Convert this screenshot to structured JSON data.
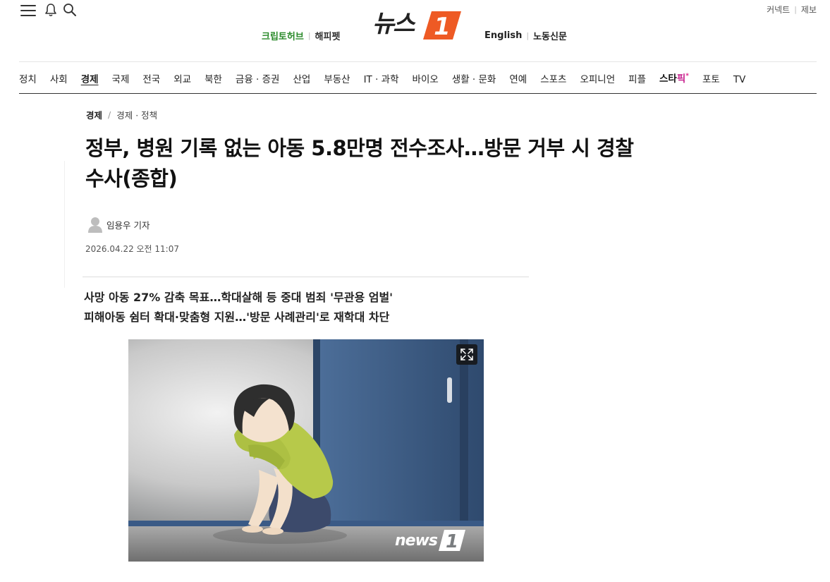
{
  "header": {
    "logo_text": "뉴스",
    "logo_number": "1",
    "util_links": [
      "커넥트",
      "제보"
    ],
    "left_links": [
      "크립토허브",
      "해피펫"
    ],
    "right_links": [
      "English",
      "노동신문"
    ]
  },
  "gnb": {
    "items": [
      "정치",
      "사회",
      "경제",
      "국제",
      "전국",
      "외교",
      "북한",
      "금융 · 증권",
      "산업",
      "부동산",
      "IT · 과학",
      "바이오",
      "생활 · 문화",
      "연예",
      "스포츠",
      "오피니언",
      "피플"
    ],
    "starpick_a": "스타",
    "starpick_b": "픽",
    "starpick_mark": "*",
    "tail": [
      "포토",
      "TV"
    ],
    "active": "경제"
  },
  "article": {
    "breadcrumb_main": "경제",
    "breadcrumb_sep": "/",
    "breadcrumb_sub": "경제 · 정책",
    "headline_line1": "정부, 병원 기록 없는 아동 5.8만명 전수조사…방문 거부 시 경찰",
    "headline_line2": "수사(종합)",
    "reporter": "임용우 기자",
    "timestamp": "2026.04.22 오전 11:07",
    "summary_line1": "사망 아동 27% 감축 목표…학대살해 등 중대 범죄 '무관용 엄벌'",
    "summary_line2": "피해아동 쉼터 확대·맞춤형 지원…'방문 사례관리'로 재학대 차단",
    "photo_watermark": "news"
  },
  "colors": {
    "brand_orange": "#ee5a24",
    "crypto_green": "#2a8a2a",
    "starpick_pink": "#c61e8c"
  }
}
